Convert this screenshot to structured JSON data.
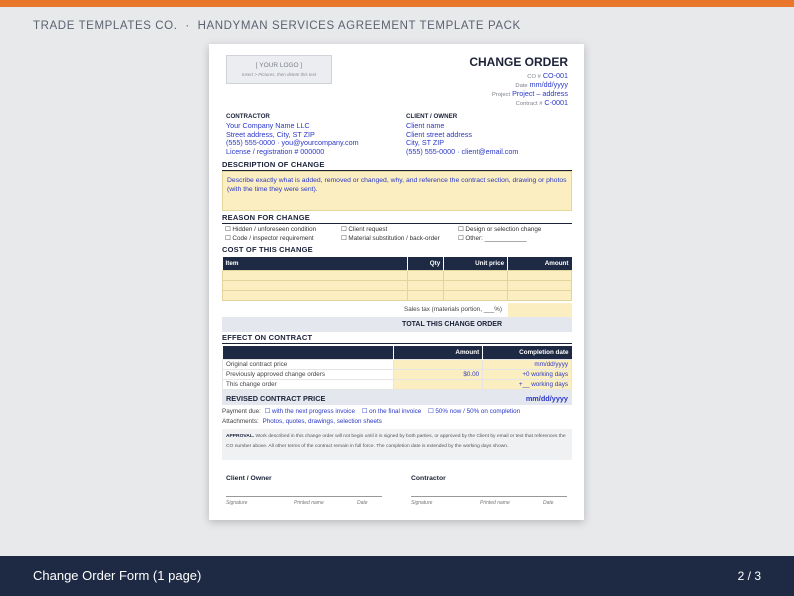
{
  "header": {
    "brand": "TRADE TEMPLATES CO.",
    "separator": "·",
    "pack_title": "HANDYMAN SERVICES AGREEMENT TEMPLATE PACK"
  },
  "footer": {
    "title": "Change Order Form (1 page)",
    "page": "2 / 3"
  },
  "colors": {
    "accent": "#e8762b",
    "navy": "#1e2a44",
    "field_blue": "#2b38c7",
    "highlight": "#fbeec0"
  },
  "doc": {
    "logo": {
      "text": "[ YOUR LOGO ]",
      "hint": "Insert > Pictures, then delete this text"
    },
    "title": "CHANGE ORDER",
    "meta": [
      {
        "label": "CO #",
        "value": "CO-001"
      },
      {
        "label": "Date",
        "value": "mm/dd/yyyy"
      },
      {
        "label": "Project",
        "value": "Project – address"
      },
      {
        "label": "Contract #",
        "value": "C-0001"
      }
    ],
    "contractor": {
      "label": "CONTRACTOR",
      "name": "Your Company Name LLC",
      "address": "Street address, City, ST ZIP",
      "contact": "(555) 555-0000 · you@yourcompany.com",
      "license": "License / registration # 000000"
    },
    "client": {
      "label": "CLIENT / OWNER",
      "name": "Client name",
      "address": "Client street address",
      "city": "City, ST ZIP",
      "contact": "(555) 555-0000 · client@email.com"
    },
    "description": {
      "heading": "DESCRIPTION OF CHANGE",
      "text": "Describe exactly what is added, removed or changed, why, and reference the contract section, drawing or photos (with the time they were sent)."
    },
    "reason": {
      "heading": "REASON FOR CHANGE",
      "checkbox": "☐",
      "options": [
        "Hidden / unforeseen condition",
        "Client request",
        "Design or selection change",
        "Code / inspector requirement",
        "Material substitution / back-order",
        "Other: ____________"
      ]
    },
    "cost": {
      "heading": "COST OF THIS CHANGE",
      "columns": [
        "Item",
        "Qty",
        "Unit price",
        "Amount"
      ],
      "tax_label": "Sales tax (materials portion, ___%)",
      "total_label": "TOTAL THIS CHANGE ORDER"
    },
    "effect": {
      "heading": "EFFECT ON CONTRACT",
      "columns": [
        "",
        "Amount",
        "Completion date"
      ],
      "rows": [
        {
          "label": "Original contract price",
          "amount": "",
          "date": "mm/dd/yyyy"
        },
        {
          "label": "Previously approved change orders",
          "amount": "$0.00",
          "date": "+0 working days"
        },
        {
          "label": "This change order",
          "amount": "",
          "date": "+__ working days"
        }
      ],
      "revised_label": "REVISED CONTRACT PRICE",
      "revised_date": "mm/dd/yyyy"
    },
    "payment": {
      "label": "Payment due:",
      "options": [
        "☐ with the next progress invoice",
        "☐ on the final invoice",
        "☐ 50% now / 50% on completion"
      ]
    },
    "attachments": {
      "label": "Attachments:",
      "value": "Photos, quotes, drawings, selection sheets"
    },
    "approval": {
      "label": "APPROVAL.",
      "text": "Work described in this change order will not begin until it is signed by both parties, or approved by the Client by email or text that references the CO number above. All other terms of the contract remain in full force. The completion date is extended by the working days shown."
    },
    "signatures": [
      {
        "title": "Client / Owner",
        "captions": [
          "Signature",
          "Printed name",
          "Date"
        ]
      },
      {
        "title": "Contractor",
        "captions": [
          "Signature",
          "Printed name",
          "Date"
        ]
      }
    ]
  }
}
